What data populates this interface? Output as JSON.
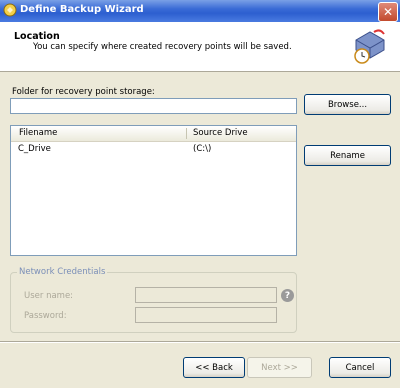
{
  "window": {
    "title": "Define Backup Wizard"
  },
  "header": {
    "title": "Location",
    "subtitle": "You can specify where created recovery points will be saved."
  },
  "folder": {
    "label": "Folder for recovery point storage:",
    "value": ""
  },
  "buttons": {
    "browse": "Browse...",
    "rename": "Rename",
    "back": "<< Back",
    "next": "Next >>",
    "cancel": "Cancel"
  },
  "list": {
    "columns": [
      "Filename",
      "Source Drive"
    ],
    "rows": [
      {
        "filename": "C_Drive",
        "source": "(C:\\)"
      }
    ]
  },
  "credentials": {
    "legend": "Network Credentials",
    "username_label": "User name:",
    "password_label": "Password:",
    "username_value": "",
    "password_value": ""
  },
  "icons": {
    "app": "wizard-app-icon",
    "header": "backup-drive-clock-icon",
    "help": "help-icon",
    "close": "close-icon"
  },
  "colors": {
    "titlebar": "#2d5fd0",
    "dialog_bg": "#ece9d8",
    "close": "#c24a2e"
  }
}
